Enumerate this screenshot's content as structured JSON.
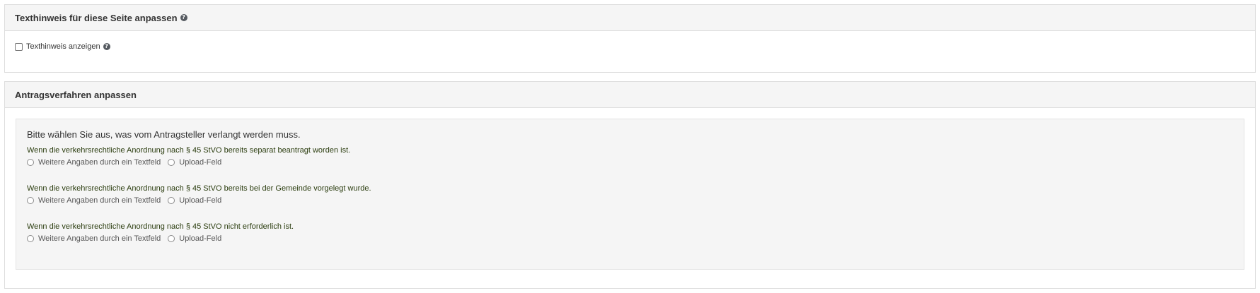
{
  "panel_text_hint": {
    "title": "Texthinweis für diese Seite anpassen",
    "help_icon": "question-circle-icon",
    "checkbox_label": "Texthinweis anzeigen",
    "checkbox_checked": false
  },
  "panel_procedure": {
    "title": "Antragsverfahren anpassen",
    "instruction": "Bitte wählen Sie aus, was vom Antragsteller verlangt werden muss.",
    "questions": [
      {
        "text": "Wenn die verkehrsrechtliche Anordnung nach § 45 StVO bereits separat beantragt worden ist.",
        "option_text": "Weitere Angaben durch ein Textfeld",
        "option_upload": "Upload-Feld"
      },
      {
        "text": "Wenn die verkehrsrechtliche Anordnung nach § 45 StVO bereits bei der Gemeinde vorgelegt wurde.",
        "option_text": "Weitere Angaben durch ein Textfeld",
        "option_upload": "Upload-Feld"
      },
      {
        "text": "Wenn die verkehrsrechtliche Anordnung nach § 45 StVO nicht erforderlich ist.",
        "option_text": "Weitere Angaben durch ein Textfeld",
        "option_upload": "Upload-Feld"
      }
    ]
  }
}
